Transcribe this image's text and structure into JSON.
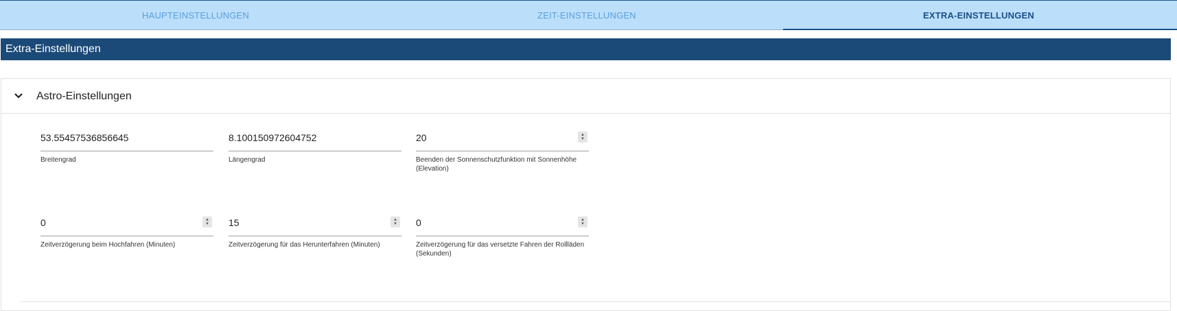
{
  "tabs": [
    {
      "label": "HAUPTEINSTELLUNGEN",
      "active": false
    },
    {
      "label": "ZEIT-EINSTELLUNGEN",
      "active": false
    },
    {
      "label": "EXTRA-EINSTELLUNGEN",
      "active": true
    }
  ],
  "section_title": "Extra-Einstellungen",
  "astro": {
    "title": "Astro-Einstellungen",
    "fields": [
      {
        "value": "53.55457536856645",
        "label": "Breitengrad"
      },
      {
        "value": "8.100150972604752",
        "label": "Längengrad"
      },
      {
        "value": "20",
        "label": "Beenden der Sonnenschutzfunktion mit Sonnenhöhe (Elevation)"
      },
      {
        "value": "0",
        "label": "Zeitverzögerung beim Hochfahren (Minuten)"
      },
      {
        "value": "15",
        "label": "Zeitverzögerung für das Herunterfahren (Minuten)"
      },
      {
        "value": "0",
        "label": "Zeitverzögerung für das versetzte Fahren der Rollläden (Sekunden)"
      }
    ]
  },
  "colors": {
    "header_bg": "#1b4a78",
    "tab_bar_bg": "#bbdefb",
    "active_tab": "#1b4f86"
  }
}
